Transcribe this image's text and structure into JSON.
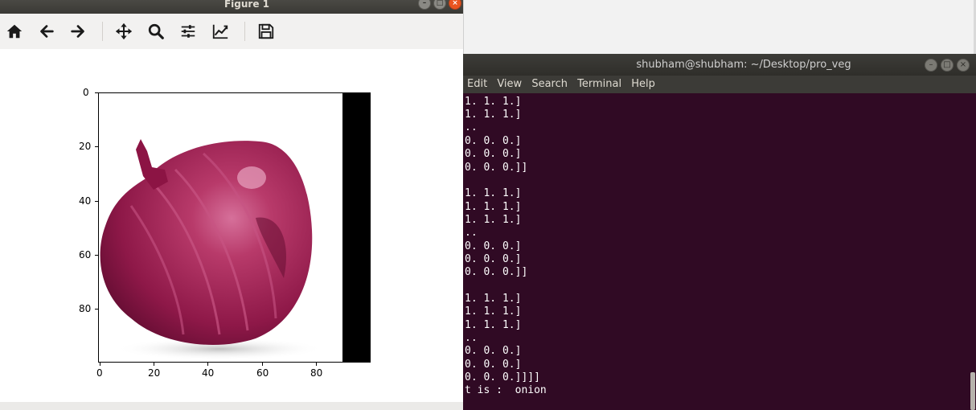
{
  "figure": {
    "title": "Figure 1",
    "window_buttons": [
      "–",
      "□",
      "×"
    ],
    "toolbar": [
      {
        "name": "home-icon"
      },
      {
        "name": "back-arrow-icon"
      },
      {
        "name": "forward-arrow-icon"
      },
      {
        "name": "pan-move-icon"
      },
      {
        "name": "zoom-icon"
      },
      {
        "name": "subplots-config-icon"
      },
      {
        "name": "edit-axis-icon"
      },
      {
        "name": "save-icon"
      }
    ],
    "plot": {
      "yticks": [
        "0",
        "20",
        "40",
        "60",
        "80"
      ],
      "xticks": [
        "0",
        "20",
        "40",
        "60",
        "80"
      ],
      "colors": {
        "onion_main": "#9c1e4e",
        "onion_light": "#d6709a",
        "band": "#000000"
      }
    }
  },
  "terminal": {
    "title": "shubham@shubham: ~/Desktop/pro_veg",
    "window_buttons": [
      "–",
      "□",
      "×"
    ],
    "menu": [
      "Edit",
      "View",
      "Search",
      "Terminal",
      "Help"
    ],
    "lines": [
      "1. 1. 1.]",
      "1. 1. 1.]",
      "..",
      "0. 0. 0.]",
      "0. 0. 0.]",
      "0. 0. 0.]]",
      "",
      "1. 1. 1.]",
      "1. 1. 1.]",
      "1. 1. 1.]",
      "..",
      "0. 0. 0.]",
      "0. 0. 0.]",
      "0. 0. 0.]]",
      "",
      "1. 1. 1.]",
      "1. 1. 1.]",
      "1. 1. 1.]",
      "..",
      "0. 0. 0.]",
      "0. 0. 0.]",
      "0. 0. 0.]]]]",
      "t is :  onion"
    ],
    "colors": {
      "background": "#300a24",
      "text": "#ffffff"
    }
  }
}
